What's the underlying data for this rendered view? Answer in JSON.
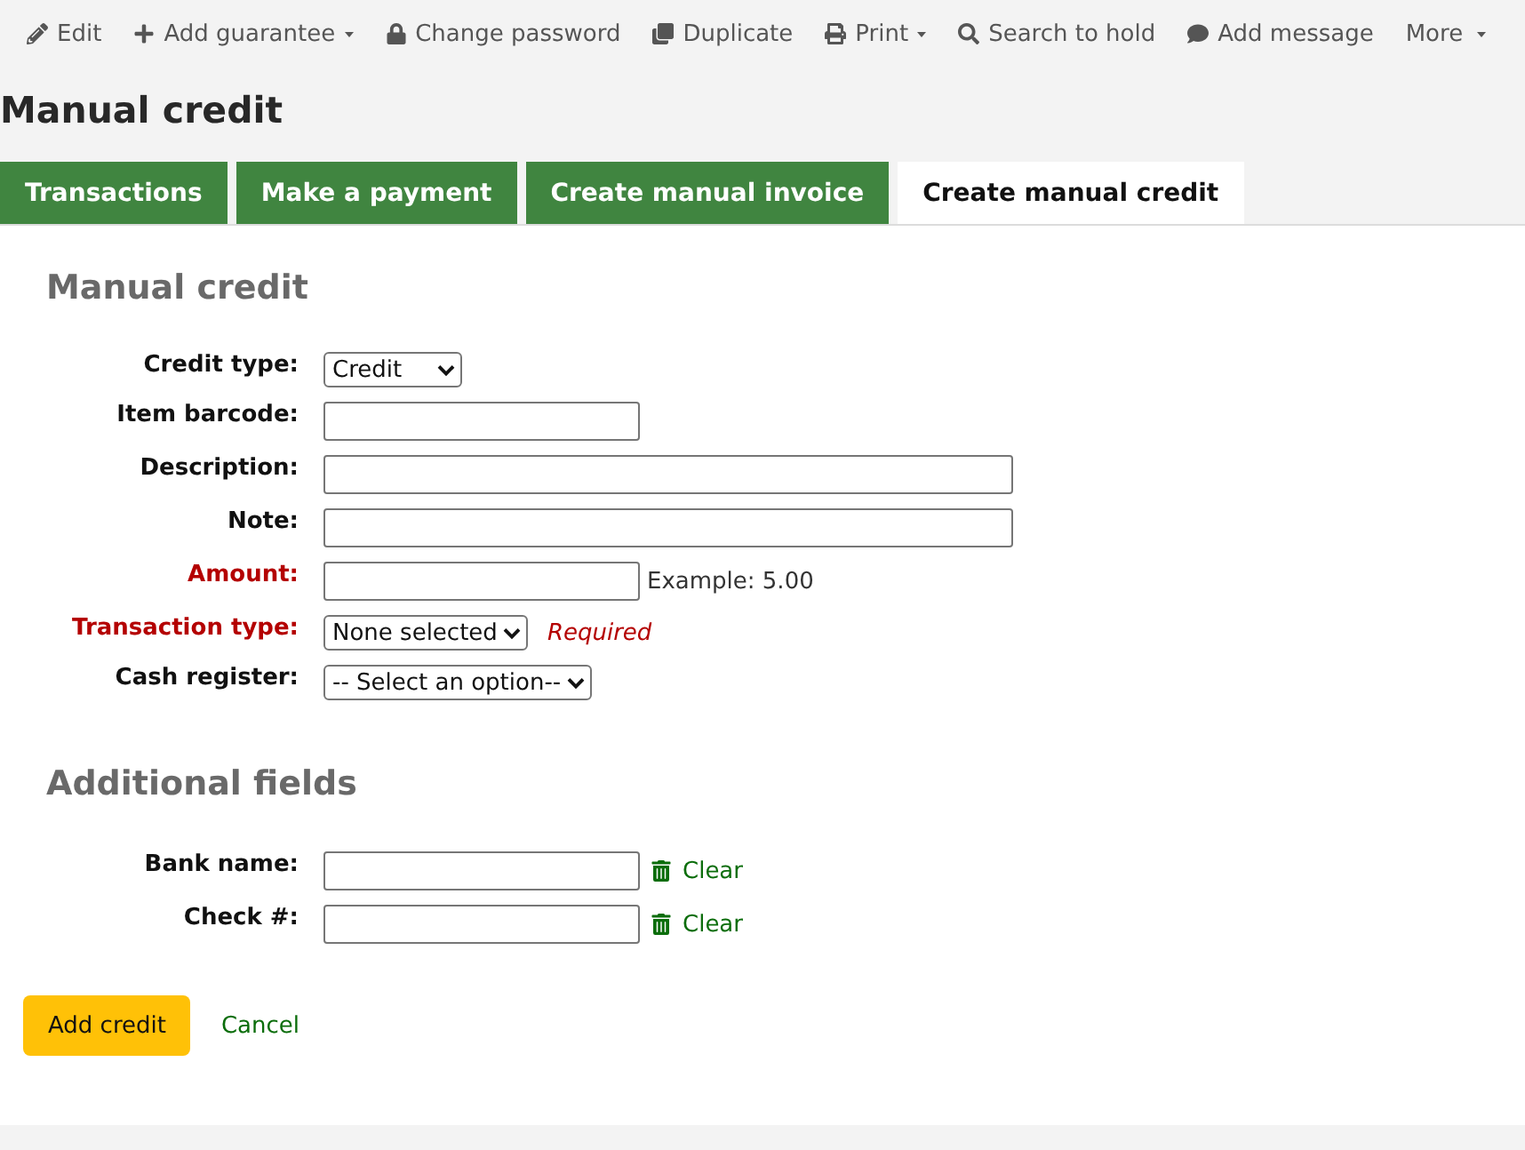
{
  "toolbar": [
    {
      "label": "Edit",
      "dropdown": false
    },
    {
      "label": "Add guarantee",
      "dropdown": true
    },
    {
      "label": "Change password",
      "dropdown": false
    },
    {
      "label": "Duplicate",
      "dropdown": false
    },
    {
      "label": "Print",
      "dropdown": true
    },
    {
      "label": "Search to hold",
      "dropdown": false
    },
    {
      "label": "Add message",
      "dropdown": false
    },
    {
      "label": "More",
      "dropdown": true
    }
  ],
  "page_title": "Manual credit",
  "tabs": [
    {
      "label": "Transactions",
      "selected": false
    },
    {
      "label": "Make a payment",
      "selected": false
    },
    {
      "label": "Create manual invoice",
      "selected": false
    },
    {
      "label": "Create manual credit",
      "selected": true
    }
  ],
  "form": {
    "title": "Manual credit",
    "fields": [
      {
        "label": "Credit type:",
        "kind": "select",
        "value": "Credit",
        "required": false
      },
      {
        "label": "Item barcode:",
        "kind": "short_text",
        "required": false
      },
      {
        "label": "Description:",
        "kind": "long_text",
        "required": false
      },
      {
        "label": "Note:",
        "kind": "long_text",
        "required": false
      },
      {
        "label": "Amount:",
        "kind": "short_text",
        "required": true,
        "hint": "Example: 5.00"
      },
      {
        "label": "Transaction type:",
        "kind": "select",
        "value": "None selected",
        "required": true,
        "warning": "Required"
      },
      {
        "label": "Cash register:",
        "kind": "select",
        "value": "-- Select an option--",
        "required": false
      }
    ]
  },
  "additional_fields": {
    "title": "Additional fields",
    "fields": [
      {
        "label": "Bank name:",
        "clear": "Clear"
      },
      {
        "label": "Check #:",
        "clear": "Clear"
      }
    ]
  },
  "actions": {
    "submit": "Add credit",
    "cancel": "Cancel"
  }
}
